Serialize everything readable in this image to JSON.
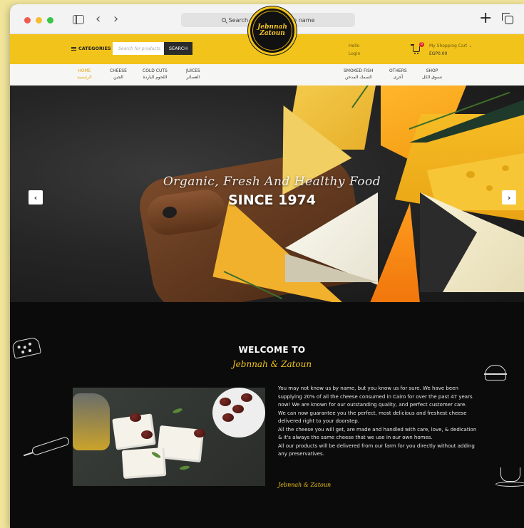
{
  "browser": {
    "address_placeholder": "Search or enter website name"
  },
  "header": {
    "categories_label": "CATEGORIES",
    "search_placeholder": "Search for products",
    "search_button": "SEARCH",
    "logo_line1": "Jebnnah",
    "logo_line2": "Zatoun",
    "hello": "Hello",
    "login": "Login",
    "cart_badge": "0",
    "cart_label": "My Shopping Cart ⌄",
    "cart_amount": "EGP0.00"
  },
  "nav": {
    "items": [
      {
        "en": "HOME",
        "ar": "الرئيسية"
      },
      {
        "en": "CHEESE",
        "ar": "الجبن"
      },
      {
        "en": "COLD CUTS",
        "ar": "اللحوم الباردة"
      },
      {
        "en": "JUICES",
        "ar": "العصائر"
      },
      {
        "en": "SMOKED FISH",
        "ar": "السمك المدخن"
      },
      {
        "en": "OTHERS",
        "ar": "أخرى"
      },
      {
        "en": "SHOP",
        "ar": "تسوق الكل"
      }
    ]
  },
  "hero": {
    "script_text": "Organic, Fresh And Healthy Food",
    "since_text": "SINCE 1974",
    "prev_arrow": "‹",
    "next_arrow": "›"
  },
  "welcome": {
    "title": "WELCOME TO",
    "brand": "Jebnnah & Zatoun",
    "paragraph1": "You may not know us by name, but you know us for sure. We have been supplying 20% of all the cheese consumed in Cairo for over the past 47 years now! We are known for our outstanding quality, and perfect customer care.",
    "paragraph2": "We can now guarantee you the perfect, most delicious and freshest cheese delivered right to your doorstep.",
    "paragraph3": "All the cheese you will get, are made and handled with care, love, & dedication & it's always the same cheese that we use in our own homes.",
    "paragraph4": "All our products will be delivered from our farm for you directly without adding any preservatives.",
    "signature": "Jebnnah & Zatoun"
  },
  "colors": {
    "brand_yellow": "#f2c41b",
    "dark_background": "#0b0b0b",
    "nav_active": "#e0a614"
  }
}
